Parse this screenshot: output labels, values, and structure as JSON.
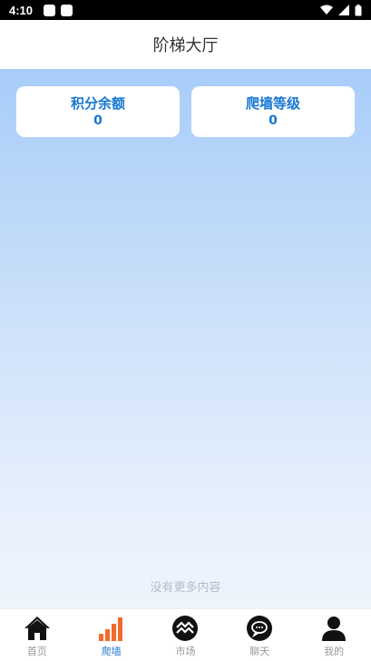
{
  "status_bar": {
    "time": "4:10"
  },
  "header": {
    "title": "阶梯大厅"
  },
  "cards": [
    {
      "label": "积分余额",
      "value": "0"
    },
    {
      "label": "爬墙等级",
      "value": "0"
    }
  ],
  "footer_note": "没有更多内容",
  "tabs": [
    {
      "label": "首页",
      "icon": "home-icon",
      "active": false
    },
    {
      "label": "爬墙",
      "icon": "signal-bars-icon",
      "active": true
    },
    {
      "label": "市场",
      "icon": "market-icon",
      "active": false
    },
    {
      "label": "聊天",
      "icon": "chat-icon",
      "active": false
    },
    {
      "label": "我的",
      "icon": "user-icon",
      "active": false
    }
  ],
  "colors": {
    "accent": "#1677d2",
    "active_tab_icon": "#f26b2b",
    "active_tab_label": "#2e7ad6"
  }
}
